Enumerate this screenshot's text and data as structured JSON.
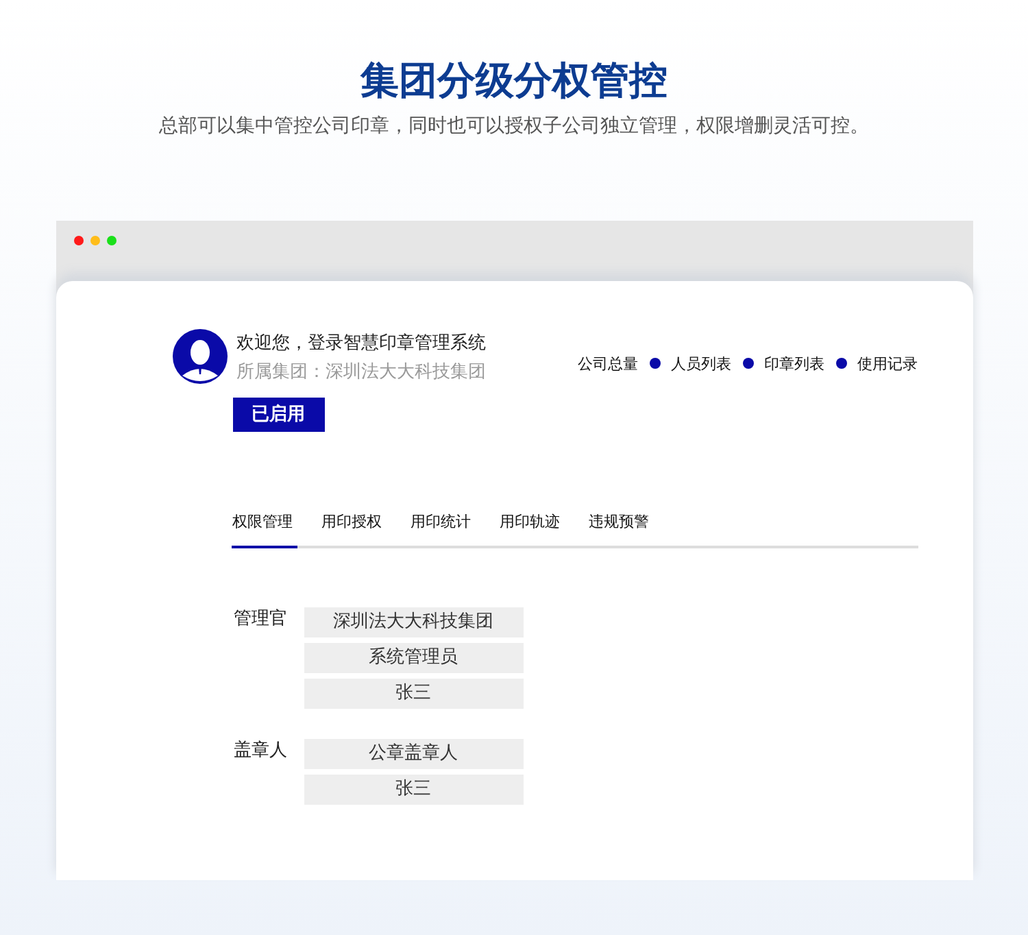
{
  "heading": "集团分级分权管控",
  "subtitle": "总部可以集中管控公司印章，同时也可以授权子公司独立管理，权限增删灵活可控。",
  "profile": {
    "welcome": "欢迎您，登录智慧印章管理系统",
    "group": "所属集团：深圳法大大科技集团",
    "status": {
      "label": "已启用",
      "on": true
    }
  },
  "nav": [
    "公司总量",
    "人员列表",
    "印章列表",
    "使用记录"
  ],
  "tabs": [
    {
      "label": "权限管理",
      "selected": true
    },
    {
      "label": "用印授权",
      "selected": false
    },
    {
      "label": "用印统计",
      "selected": false
    },
    {
      "label": "用印轨迹",
      "selected": false
    },
    {
      "label": "违规预警",
      "selected": false
    }
  ],
  "roles": [
    {
      "label": "管理官",
      "members": [
        "深圳法大大科技集团",
        "系统管理员",
        "张三"
      ]
    },
    {
      "label": "盖章人",
      "members": [
        "公章盖章人",
        "张三"
      ]
    }
  ]
}
